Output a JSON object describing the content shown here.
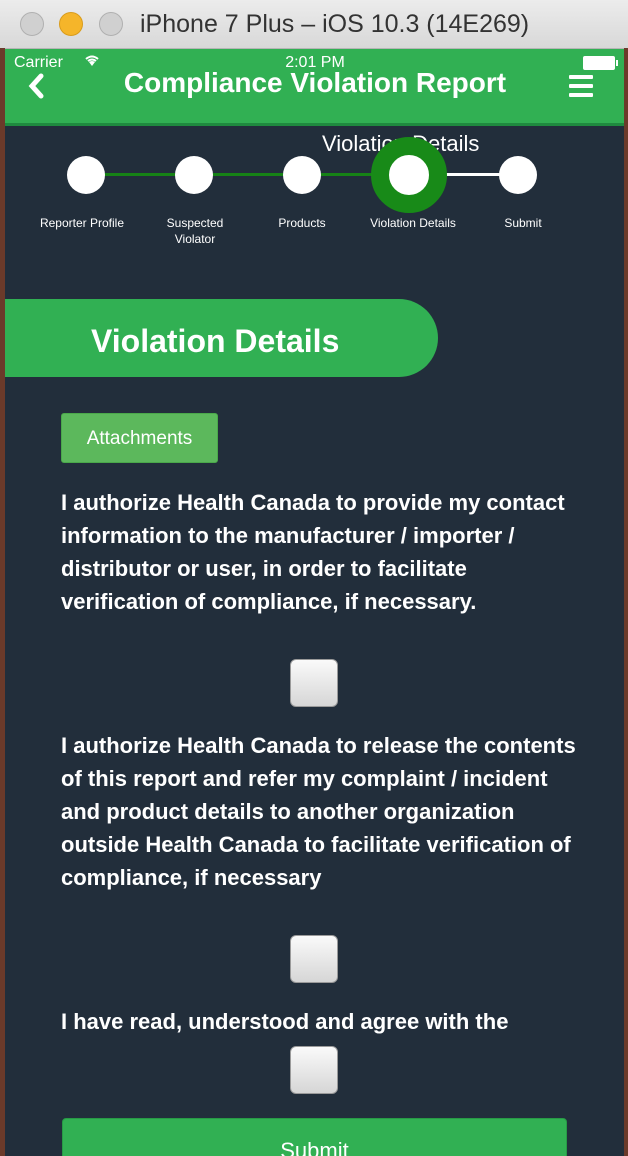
{
  "window": {
    "title": "iPhone 7 Plus – iOS 10.3 (14E269)"
  },
  "status_bar": {
    "carrier": "Carrier",
    "time": "2:01 PM"
  },
  "header": {
    "back_icon": "chevron-left-icon",
    "title": "Compliance Violation Report",
    "menu_icon": "hamburger-menu-icon"
  },
  "stepper": {
    "current_title": "Violation Details",
    "steps": [
      {
        "label": "Reporter Profile"
      },
      {
        "label": "Suspected Violator"
      },
      {
        "label": "Products"
      },
      {
        "label": "Violation Details",
        "active": true
      },
      {
        "label": "Submit"
      }
    ]
  },
  "section": {
    "title": "Violation Details"
  },
  "attachments_button": "Attachments",
  "consents": [
    {
      "text": "I authorize Health Canada to provide my contact information to the manufacturer / importer / distributor or user, in order to facilitate verification of compliance, if necessary.",
      "checked": false
    },
    {
      "text": "I authorize Health Canada to release the contents of this report and refer my complaint / incident and product details to another organization outside Health Canada to facilitate verification of compliance, if necessary",
      "checked": false
    },
    {
      "text": "I have read, understood and agree with the",
      "checked": false
    }
  ],
  "submit_button": "Submit",
  "colors": {
    "accent": "#31b053",
    "background": "#222e3b",
    "active_step": "#188a18"
  }
}
